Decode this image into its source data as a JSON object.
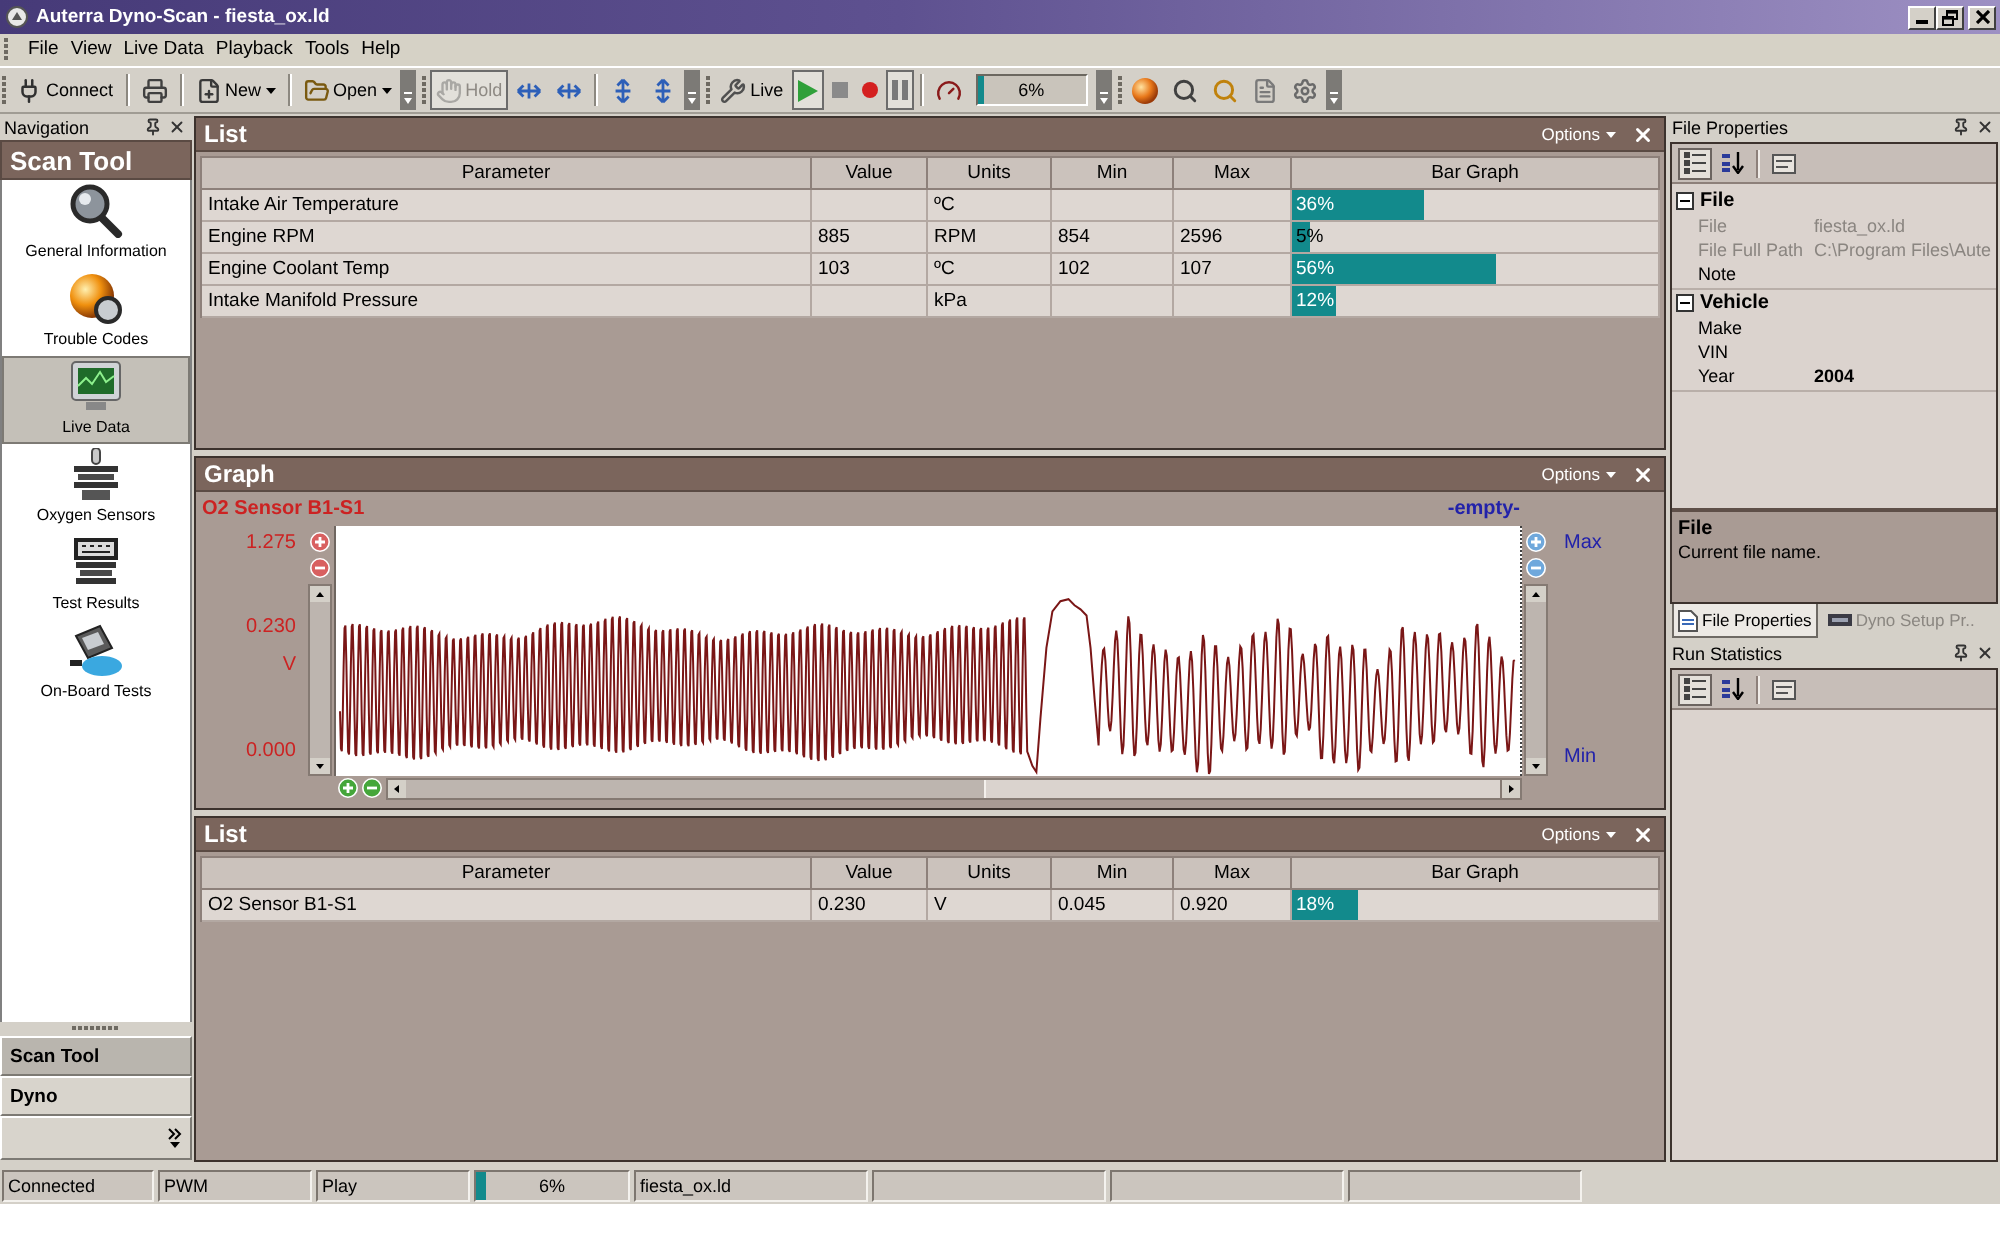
{
  "window": {
    "title": "Auterra Dyno-Scan - fiesta_ox.ld"
  },
  "menu": [
    "File",
    "View",
    "Live Data",
    "Playback",
    "Tools",
    "Help"
  ],
  "toolbars": [
    {
      "items": [
        {
          "kind": "button",
          "label": "Connect",
          "pressed": false,
          "disabled": false
        },
        {
          "kind": "separator"
        },
        {
          "kind": "button",
          "pressed": false,
          "disabled": false
        },
        {
          "kind": "separator"
        },
        {
          "kind": "button",
          "label": "New",
          "dropdown": true,
          "pressed": false,
          "disabled": false
        },
        {
          "kind": "separator"
        },
        {
          "kind": "button",
          "label": "Open",
          "dropdown": true,
          "pressed": false,
          "disabled": false
        }
      ]
    },
    {
      "items": [
        {
          "kind": "button",
          "label": "Hold",
          "pressed": true,
          "disabled": true
        },
        {
          "kind": "button",
          "pressed": false,
          "disabled": false
        },
        {
          "kind": "button",
          "pressed": false,
          "disabled": false
        },
        {
          "kind": "separator"
        },
        {
          "kind": "button",
          "pressed": false,
          "disabled": false
        },
        {
          "kind": "button",
          "pressed": false,
          "disabled": false
        }
      ]
    },
    {
      "items": [
        {
          "kind": "button",
          "label": "Live",
          "pressed": false,
          "disabled": false
        },
        {
          "kind": "button",
          "pressed": true,
          "disabled": false
        },
        {
          "kind": "button",
          "pressed": false,
          "disabled": false
        },
        {
          "kind": "button",
          "pressed": false,
          "disabled": false
        },
        {
          "kind": "button",
          "pressed": true,
          "disabled": false
        },
        {
          "kind": "separator"
        },
        {
          "kind": "button",
          "pressed": false,
          "disabled": false
        },
        {
          "kind": "progress",
          "level": 0.06,
          "label": "6%"
        }
      ]
    },
    {
      "items": [
        {
          "kind": "button",
          "pressed": false,
          "disabled": false
        },
        {
          "kind": "button",
          "pressed": false,
          "disabled": false
        },
        {
          "kind": "button",
          "pressed": false,
          "disabled": false
        },
        {
          "kind": "button",
          "pressed": false,
          "disabled": false
        },
        {
          "kind": "button",
          "pressed": false,
          "disabled": false
        }
      ]
    }
  ],
  "navigation": {
    "title": "Navigation",
    "group": "Scan Tool",
    "items": [
      {
        "label": "General Information",
        "selected": false
      },
      {
        "label": "Trouble Codes",
        "selected": false
      },
      {
        "label": "Live Data",
        "selected": true
      },
      {
        "label": "Oxygen Sensors",
        "selected": false
      },
      {
        "label": "Test Results",
        "selected": false
      },
      {
        "label": "On-Board Tests",
        "selected": false
      }
    ],
    "sections": [
      {
        "label": "Scan Tool",
        "selected": true
      },
      {
        "label": "Dyno",
        "selected": false
      }
    ]
  },
  "upper_list": {
    "title": "List",
    "options": "Options",
    "columns": [
      "Parameter",
      "Value",
      "Units",
      "Min",
      "Max",
      "Bar Graph"
    ],
    "rows": [
      {
        "parameter": "Intake Air Temperature",
        "units": "ºC",
        "bar": {
          "level": 0.36,
          "label": "36%"
        }
      },
      {
        "parameter": "Engine RPM",
        "value": "885",
        "units": "RPM",
        "min": "854",
        "max": "2596",
        "bar": {
          "level": 0.05,
          "label": "5%"
        }
      },
      {
        "parameter": "Engine Coolant Temp",
        "value": "103",
        "units": "ºC",
        "min": "102",
        "max": "107",
        "bar": {
          "level": 0.56,
          "label": "56%"
        }
      },
      {
        "parameter": "Intake Manifold Pressure",
        "units": "kPa",
        "bar": {
          "level": 0.12,
          "label": "12%"
        }
      }
    ]
  },
  "graph": {
    "title": "Graph",
    "options": "Options",
    "traces": [
      {
        "name": "O2 Sensor B1-S1",
        "color": "#cc2222",
        "scale": {
          "max": "1.275",
          "reading": "0.230",
          "unit": "V",
          "min": "0.000"
        }
      },
      {
        "name": "-empty-",
        "color": "#2222aa",
        "scale": {
          "max": "Max",
          "min": "Min"
        }
      }
    ]
  },
  "lower_list": {
    "title": "List",
    "options": "Options",
    "columns": [
      "Parameter",
      "Value",
      "Units",
      "Min",
      "Max",
      "Bar Graph"
    ],
    "rows": [
      {
        "parameter": "O2 Sensor B1-S1",
        "value": "0.230",
        "units": "V",
        "min": "0.045",
        "max": "0.920",
        "bar": {
          "level": 0.18,
          "label": "18%"
        }
      }
    ]
  },
  "file_properties": {
    "title": "File Properties",
    "toolbar": [
      {
        "pressed": true
      },
      {
        "pressed": false
      },
      {
        "pressed": false
      }
    ],
    "categories": [
      {
        "name": "File",
        "expanded": true,
        "rows": [
          {
            "name": "File",
            "value": "fiesta_ox.ld",
            "disabled": true,
            "modified": false
          },
          {
            "name": "File Full Path",
            "value": "C:\\Program Files\\Aute",
            "disabled": true,
            "modified": false
          },
          {
            "name": "Note",
            "disabled": false
          }
        ]
      },
      {
        "name": "Vehicle",
        "expanded": true,
        "rows": [
          {
            "name": "Make",
            "disabled": false
          },
          {
            "name": "VIN",
            "disabled": false
          },
          {
            "name": "Year",
            "value": "2004",
            "disabled": false,
            "modified": true
          }
        ]
      }
    ],
    "help": {
      "title": "File",
      "text": "Current file name."
    }
  },
  "tabs": [
    {
      "label": "File Properties",
      "selected": true
    },
    {
      "label": "Dyno Setup Pr..",
      "selected": false
    }
  ],
  "run_statistics": {
    "title": "Run Statistics",
    "toolbar": [
      {
        "pressed": true
      },
      {
        "pressed": false
      },
      {
        "pressed": false
      }
    ]
  },
  "status_bar": [
    {
      "kind": "text",
      "label": "Connected"
    },
    {
      "kind": "text",
      "label": "PWM"
    },
    {
      "kind": "text",
      "label": "Play"
    },
    {
      "kind": "progress",
      "level": 0.06,
      "label": "6%"
    },
    {
      "kind": "text",
      "label": "fiesta_ox.ld"
    }
  ]
}
